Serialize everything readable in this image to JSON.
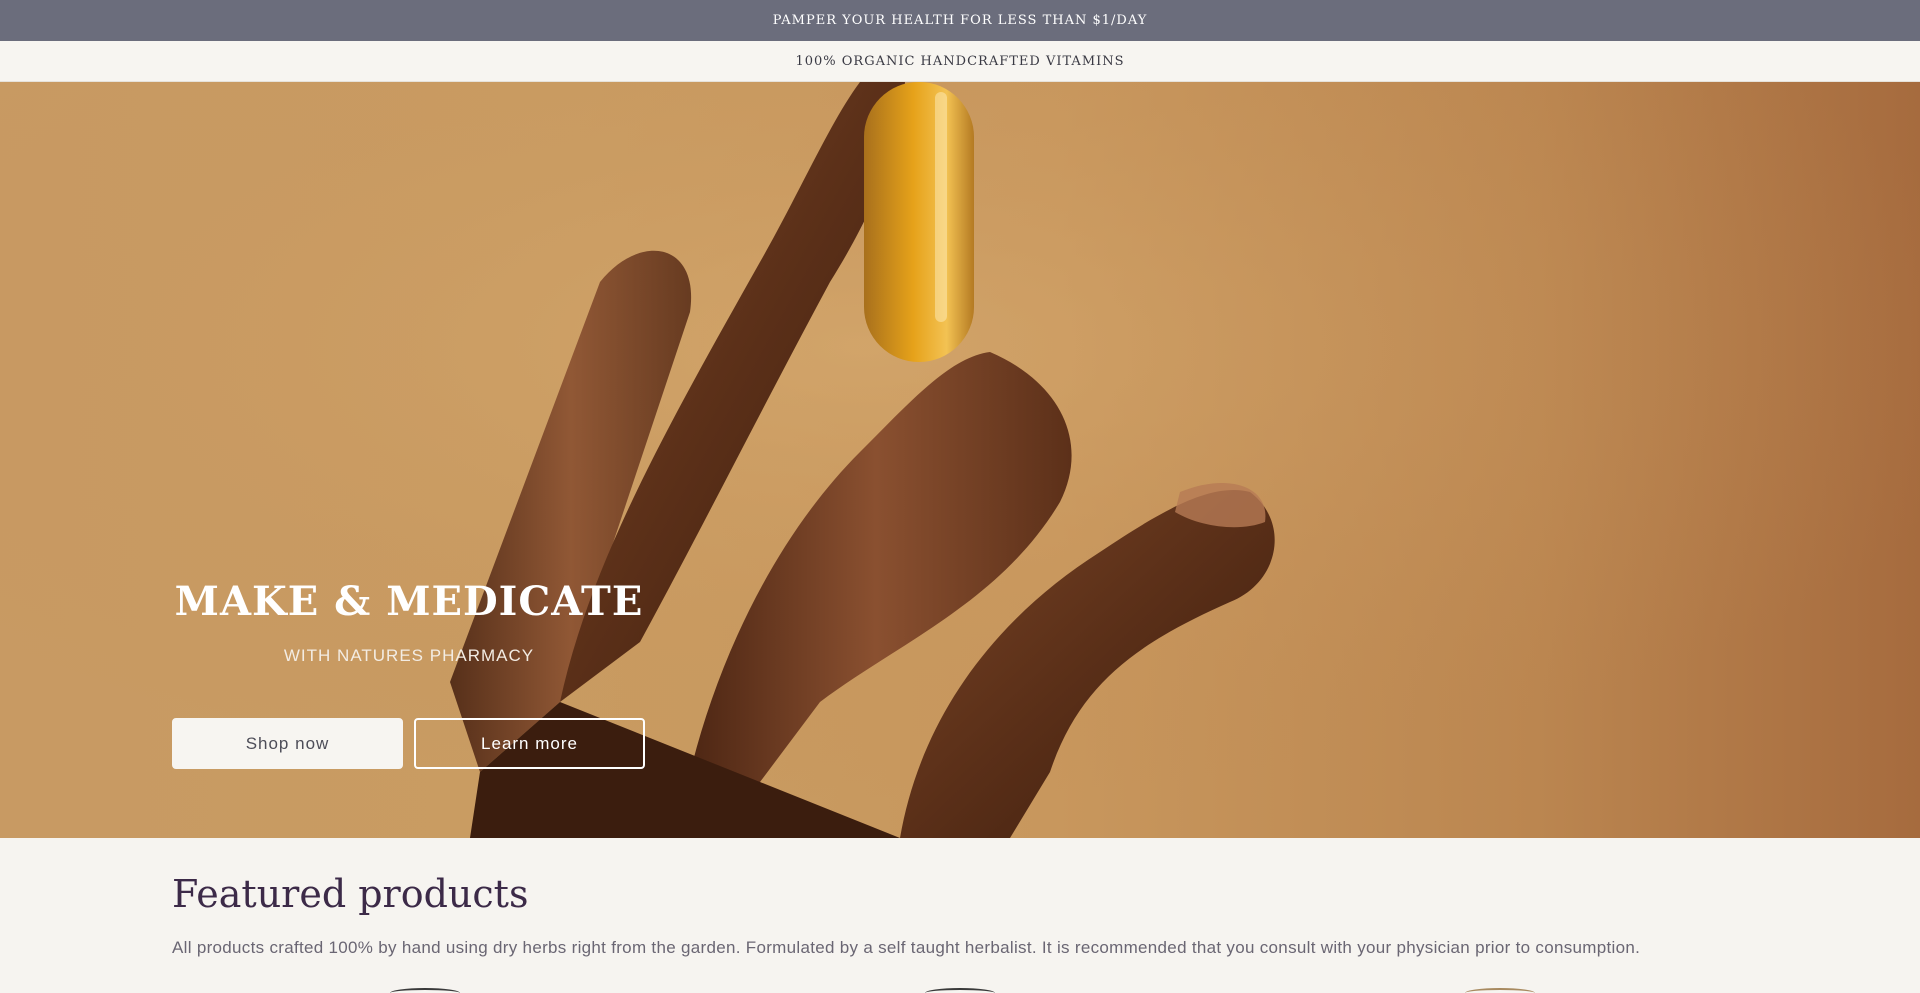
{
  "announcement": {
    "primary": "PAMPER YOUR HEALTH FOR LESS THAN $1/DAY",
    "secondary": "100% ORGANIC HANDCRAFTED VITAMINS"
  },
  "colors": {
    "announcement_bg": "#6b6d7c",
    "page_bg": "#f6f4f0",
    "heading_color": "#3c2a48",
    "hero_bg": "#c89a63"
  },
  "hero": {
    "title": "MAKE & MEDICATE",
    "subtitle": "WITH NATURES PHARMACY",
    "primary_button": "Shop now",
    "secondary_button": "Learn more"
  },
  "featured": {
    "title": "Featured products",
    "description": "All products crafted 100% by hand using dry herbs right from the garden. Formulated by a self taught herbalist. It is recommended that you consult with your physician prior to consumption."
  }
}
